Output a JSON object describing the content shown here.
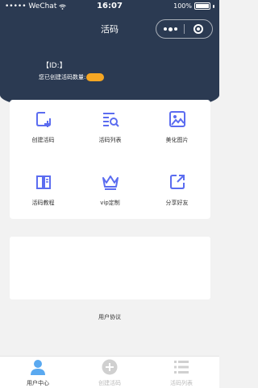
{
  "status_bar": {
    "carrier": "••••• WeChat",
    "time": "16:07",
    "battery": "100%"
  },
  "nav": {
    "title": "活码"
  },
  "user": {
    "id_label": "【ID:】",
    "count_label": "您已创建活码数量:"
  },
  "grid": [
    {
      "label": "创建活码",
      "icon": "create-code-icon"
    },
    {
      "label": "活码列表",
      "icon": "code-list-icon"
    },
    {
      "label": "美化图片",
      "icon": "image-icon"
    },
    {
      "label": "活码教程",
      "icon": "tutorial-book-icon"
    },
    {
      "label": "vip定制",
      "icon": "crown-icon"
    },
    {
      "label": "分享好友",
      "icon": "share-icon"
    }
  ],
  "footer": {
    "agreement": "用户协议"
  },
  "tabbar": [
    {
      "label": "用户中心",
      "icon": "user-icon",
      "active": true
    },
    {
      "label": "创建活码",
      "icon": "plus-circle-icon",
      "active": false
    },
    {
      "label": "活码列表",
      "icon": "list-icon",
      "active": false
    }
  ],
  "colors": {
    "header": "#2b3a52",
    "accent": "#5b6cf0",
    "badge": "#f5a623",
    "tab_active": "#5aa9f0",
    "tab_inactive": "#d0d0d0"
  }
}
